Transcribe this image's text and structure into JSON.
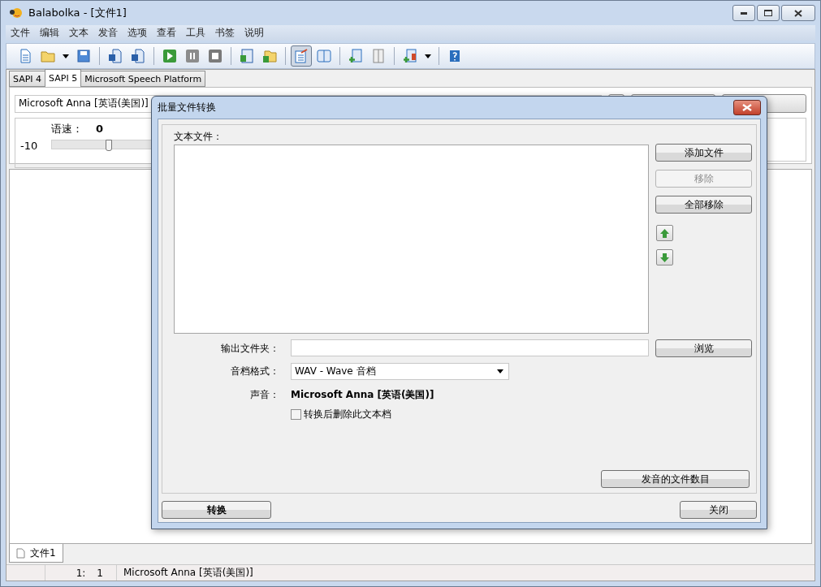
{
  "window": {
    "title": "Balabolka - [文件1]"
  },
  "menu": [
    "文件",
    "编辑",
    "文本",
    "发音",
    "选项",
    "查看",
    "工具",
    "书签",
    "说明"
  ],
  "toolbar": [
    {
      "kind": "new",
      "pressed": false
    },
    {
      "kind": "open",
      "pressed": false
    },
    {
      "kind": "dropdown",
      "pressed": false
    },
    {
      "kind": "save",
      "pressed": false
    },
    {
      "kind": "sep"
    },
    {
      "kind": "audio",
      "pressed": false
    },
    {
      "kind": "audio2",
      "pressed": false
    },
    {
      "kind": "sep"
    },
    {
      "kind": "play",
      "pressed": false
    },
    {
      "kind": "pause",
      "pressed": false
    },
    {
      "kind": "stop",
      "pressed": false
    },
    {
      "kind": "sep"
    },
    {
      "kind": "clip",
      "pressed": false
    },
    {
      "kind": "folderplay",
      "pressed": false
    },
    {
      "kind": "sep"
    },
    {
      "kind": "edit",
      "pressed": true
    },
    {
      "kind": "ab",
      "pressed": false
    },
    {
      "kind": "sep"
    },
    {
      "kind": "addbook",
      "pressed": false
    },
    {
      "kind": "greybook",
      "pressed": false
    },
    {
      "kind": "sep"
    },
    {
      "kind": "splitbook",
      "pressed": false
    },
    {
      "kind": "dropdown",
      "pressed": false
    },
    {
      "kind": "sep"
    },
    {
      "kind": "help",
      "pressed": false
    }
  ],
  "engine_tabs": [
    {
      "label": "SAPI 4",
      "selected": false
    },
    {
      "label": "SAPI 5",
      "selected": true
    },
    {
      "label": "Microsoft Speech Platform",
      "selected": false
    }
  ],
  "voice": {
    "value": "Microsoft Anna [英语(美国)]",
    "rate_label": "语速：",
    "rate_value": "0",
    "rate_min": "-10",
    "level": 0.5
  },
  "document_tabs": [
    {
      "label": "文件1",
      "selected": true
    }
  ],
  "status_bar": {
    "line": "1:",
    "column": "1",
    "voice": "Microsoft Anna [英语(美国)]"
  },
  "dialog": {
    "title": "批量文件转换",
    "files_label": "文本文件：",
    "side_buttons": [
      {
        "label": "添加文件",
        "disabled": false
      },
      {
        "label": "移除",
        "disabled": true
      },
      {
        "label": "全部移除",
        "disabled": false
      }
    ],
    "output_label": "输出文件夹：",
    "browse": "浏览",
    "format_label": "音档格式：",
    "format_value": "WAV - Wave 音档",
    "voice_label": "声音：",
    "voice_value": "Microsoft Anna [英语(美国)]",
    "delete_checkbox": {
      "label": "转换后删除此文本档",
      "checked": false
    },
    "count_button": "发音的文件数目",
    "convert_button": "转换",
    "close_button": "关闭"
  }
}
